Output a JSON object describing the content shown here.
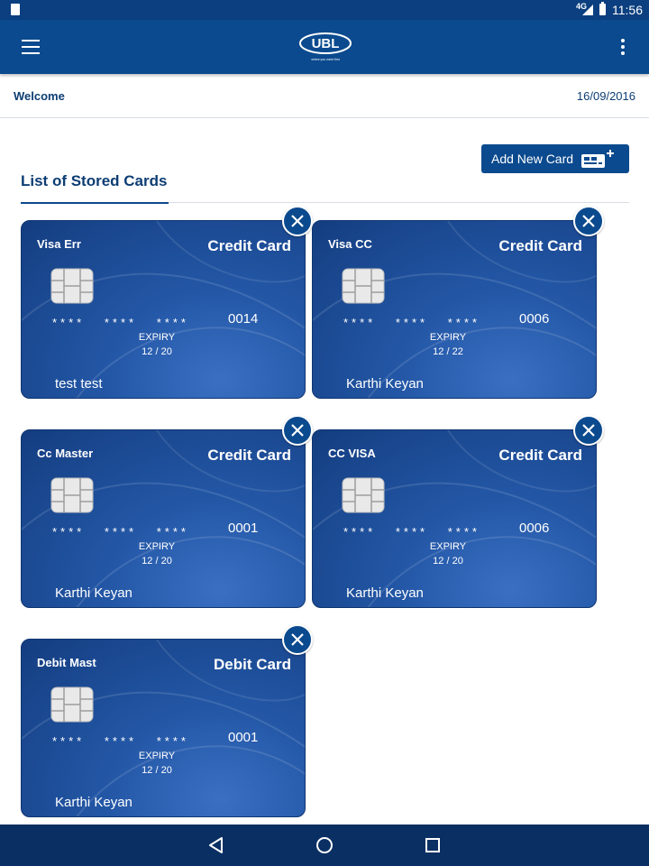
{
  "status_bar": {
    "network": "4G",
    "time": "11:56"
  },
  "app_bar": {
    "logo_text": "UBL",
    "logo_tagline": "where you come first",
    "brand_color": "#0b4a8e"
  },
  "welcome": {
    "label": "Welcome",
    "date": "16/09/2016"
  },
  "section": {
    "title": "List of Stored Cards",
    "add_button_label": "Add New Card"
  },
  "cards": [
    {
      "name": "Visa Err",
      "type": "Credit Card",
      "mask": "**** **** ****",
      "last4": "0014",
      "expiry_label": "EXPIRY",
      "expiry": "12 / 20",
      "holder": "test test"
    },
    {
      "name": "Visa CC",
      "type": "Credit Card",
      "mask": "**** **** ****",
      "last4": "0006",
      "expiry_label": "EXPIRY",
      "expiry": "12 / 22",
      "holder": "Karthi Keyan"
    },
    {
      "name": "Cc Master",
      "type": "Credit Card",
      "mask": "**** **** ****",
      "last4": "0001",
      "expiry_label": "EXPIRY",
      "expiry": "12 / 20",
      "holder": "Karthi Keyan"
    },
    {
      "name": "CC VISA",
      "type": "Credit Card",
      "mask": "**** **** ****",
      "last4": "0006",
      "expiry_label": "EXPIRY",
      "expiry": "12 / 20",
      "holder": "Karthi Keyan"
    },
    {
      "name": "Debit Mast",
      "type": "Debit Card",
      "mask": "**** **** ****",
      "last4": "0001",
      "expiry_label": "EXPIRY",
      "expiry": "12 / 20",
      "holder": "Karthi Keyan"
    }
  ],
  "icons": {
    "menu": "hamburger-menu-icon",
    "more": "more-vert-icon",
    "remove": "close-icon",
    "add_card": "card-plus-icon",
    "chip": "chip-icon",
    "back": "back-triangle-icon",
    "home": "home-circle-icon",
    "recent": "recent-square-icon"
  }
}
